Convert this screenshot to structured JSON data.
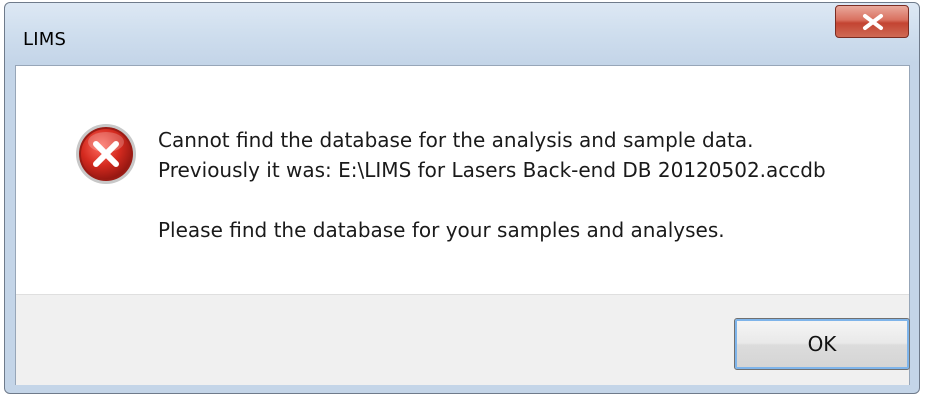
{
  "window": {
    "title": "LIMS",
    "close_glyph": "x"
  },
  "message": {
    "line1": "Cannot find the database for the analysis and sample data.",
    "line2": "Previously it was:  E:\\LIMS for Lasers Back-end DB 20120502.accdb",
    "line3": "Please find the database for your samples and analyses."
  },
  "icon": {
    "name": "error-icon",
    "color": "#c0211b"
  },
  "buttons": {
    "ok_label": "OK"
  }
}
